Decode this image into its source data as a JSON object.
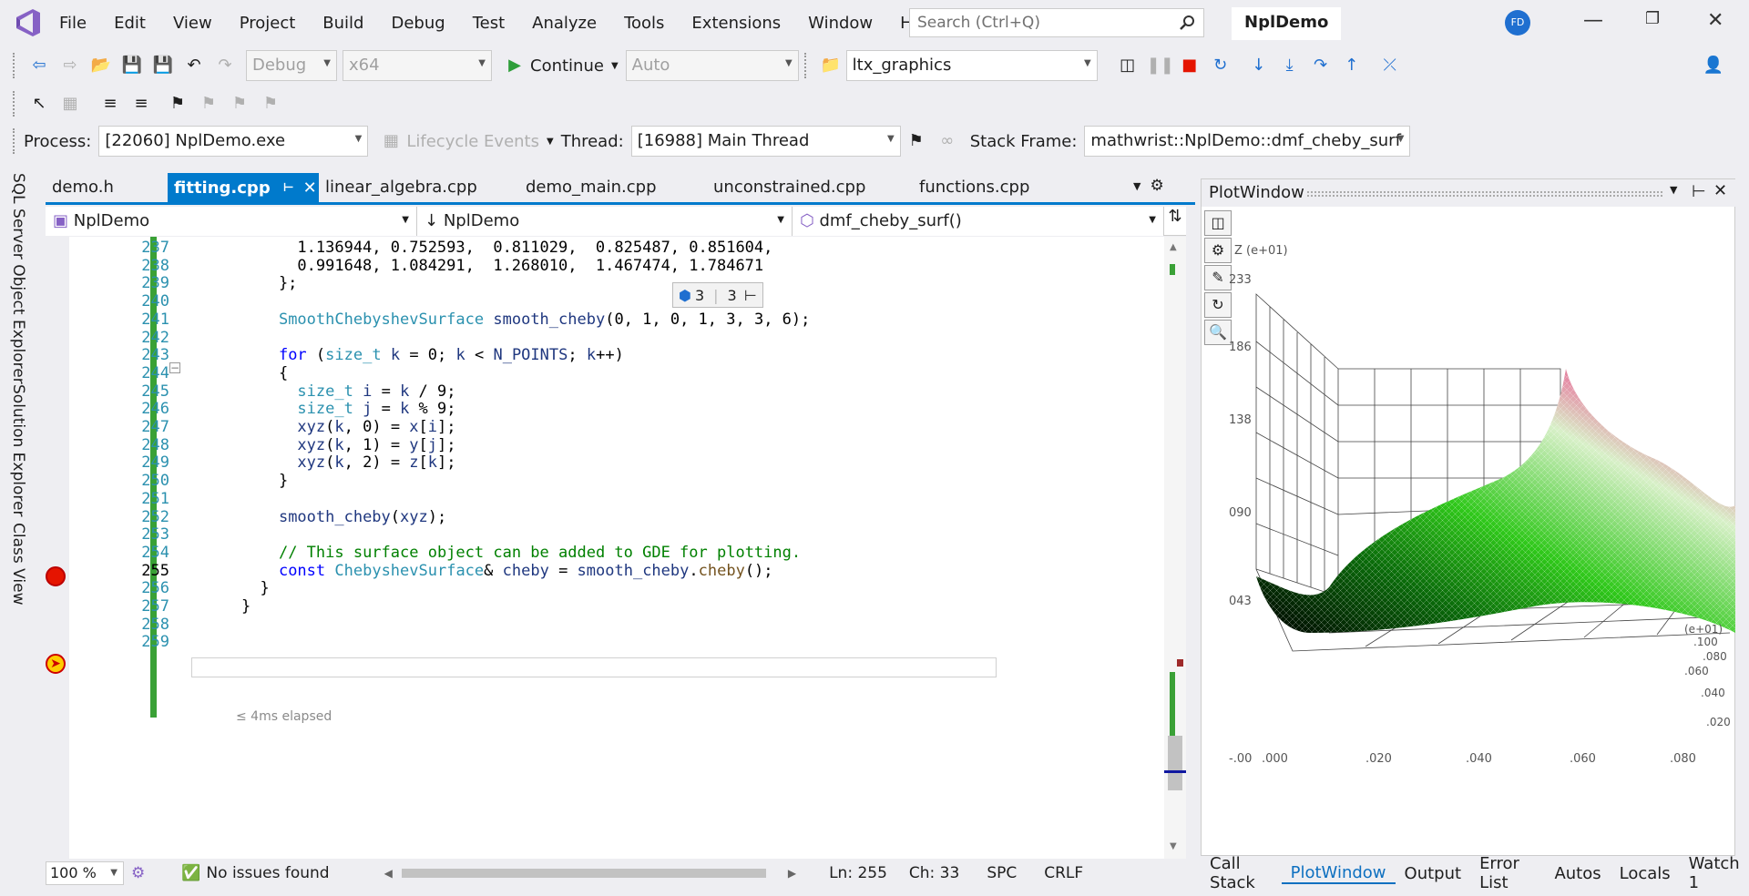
{
  "menu": [
    "File",
    "Edit",
    "View",
    "Project",
    "Build",
    "Debug",
    "Test",
    "Analyze",
    "Tools",
    "Extensions",
    "Window",
    "Help"
  ],
  "search": {
    "placeholder": "Search (Ctrl+Q)"
  },
  "solution_name": "NplDemo",
  "user_initials": "FD",
  "toolbar1": {
    "config": "Debug",
    "platform": "x64",
    "continue_label": "Continue",
    "auto": "Auto",
    "project_combo": "ltx_graphics"
  },
  "debug_location": {
    "process_label": "Process:",
    "process_value": "[22060] NplDemo.exe",
    "lifecycle_label": "Lifecycle Events",
    "thread_label": "Thread:",
    "thread_value": "[16988] Main Thread",
    "stackframe_label": "Stack Frame:",
    "stackframe_value": "mathwrist::NplDemo::dmf_cheby_surf"
  },
  "doc_tabs": [
    "demo.h",
    "fitting.cpp",
    "linear_algebra.cpp",
    "demo_main.cpp",
    "unconstrained.cpp",
    "functions.cpp"
  ],
  "active_tab": "fitting.cpp",
  "navbar": {
    "project": "NplDemo",
    "scope": "NplDemo",
    "member": "dmf_cheby_surf()"
  },
  "left_dock": [
    "SQL Server Object Explorer",
    "Solution Explorer",
    "Class View"
  ],
  "code_lines": [
    {
      "n": "237",
      "segs": [
        [
          "      1.136944, 0.752593,  0.811029,  0.825487, 0.851604,",
          "nm"
        ]
      ]
    },
    {
      "n": "238",
      "segs": [
        [
          "      0.991648, 1.084291,  1.268010,  1.467474, 1.784671",
          "nm"
        ]
      ]
    },
    {
      "n": "239",
      "segs": [
        [
          "    };",
          "nm"
        ]
      ]
    },
    {
      "n": "240",
      "segs": [
        [
          "",
          "nm"
        ]
      ]
    },
    {
      "n": "241",
      "segs": [
        [
          "    ",
          "nm"
        ],
        [
          "SmoothChebyshevSurface",
          "ty"
        ],
        [
          " ",
          "nm"
        ],
        [
          "smooth_cheby",
          "va"
        ],
        [
          "(0, 1, 0, 1, 3, 3, 6);",
          "nm"
        ]
      ]
    },
    {
      "n": "242",
      "segs": [
        [
          "",
          "nm"
        ]
      ]
    },
    {
      "n": "243",
      "segs": [
        [
          "    ",
          "nm"
        ],
        [
          "for",
          "kw"
        ],
        [
          " (",
          "nm"
        ],
        [
          "size_t",
          "ty"
        ],
        [
          " ",
          "nm"
        ],
        [
          "k",
          "va"
        ],
        [
          " = 0; ",
          "nm"
        ],
        [
          "k",
          "va"
        ],
        [
          " < ",
          "nm"
        ],
        [
          "N_POINTS",
          "va"
        ],
        [
          "; ",
          "nm"
        ],
        [
          "k",
          "va"
        ],
        [
          "++)",
          "nm"
        ]
      ]
    },
    {
      "n": "244",
      "segs": [
        [
          "    {",
          "nm"
        ]
      ]
    },
    {
      "n": "245",
      "segs": [
        [
          "      ",
          "nm"
        ],
        [
          "size_t",
          "ty"
        ],
        [
          " ",
          "nm"
        ],
        [
          "i",
          "va"
        ],
        [
          " = ",
          "nm"
        ],
        [
          "k",
          "va"
        ],
        [
          " / 9;",
          "nm"
        ]
      ]
    },
    {
      "n": "246",
      "segs": [
        [
          "      ",
          "nm"
        ],
        [
          "size_t",
          "ty"
        ],
        [
          " ",
          "nm"
        ],
        [
          "j",
          "va"
        ],
        [
          " = ",
          "nm"
        ],
        [
          "k",
          "va"
        ],
        [
          " % 9;",
          "nm"
        ]
      ]
    },
    {
      "n": "247",
      "segs": [
        [
          "      ",
          "nm"
        ],
        [
          "xyz",
          "va"
        ],
        [
          "(",
          "nm"
        ],
        [
          "k",
          "va"
        ],
        [
          ", 0) = ",
          "nm"
        ],
        [
          "x",
          "va"
        ],
        [
          "[",
          "nm"
        ],
        [
          "i",
          "va"
        ],
        [
          "];",
          "nm"
        ]
      ]
    },
    {
      "n": "248",
      "segs": [
        [
          "      ",
          "nm"
        ],
        [
          "xyz",
          "va"
        ],
        [
          "(",
          "nm"
        ],
        [
          "k",
          "va"
        ],
        [
          ", 1) = ",
          "nm"
        ],
        [
          "y",
          "va"
        ],
        [
          "[",
          "nm"
        ],
        [
          "j",
          "va"
        ],
        [
          "];",
          "nm"
        ]
      ]
    },
    {
      "n": "249",
      "segs": [
        [
          "      ",
          "nm"
        ],
        [
          "xyz",
          "va"
        ],
        [
          "(",
          "nm"
        ],
        [
          "k",
          "va"
        ],
        [
          ", 2) = ",
          "nm"
        ],
        [
          "z",
          "va"
        ],
        [
          "[",
          "nm"
        ],
        [
          "k",
          "va"
        ],
        [
          "];",
          "nm"
        ]
      ]
    },
    {
      "n": "250",
      "segs": [
        [
          "    }",
          "nm"
        ]
      ]
    },
    {
      "n": "251",
      "segs": [
        [
          "",
          "nm"
        ]
      ]
    },
    {
      "n": "252",
      "segs": [
        [
          "    ",
          "nm"
        ],
        [
          "smooth_cheby",
          "va"
        ],
        [
          "(",
          "nm"
        ],
        [
          "xyz",
          "va"
        ],
        [
          ");",
          "nm"
        ]
      ]
    },
    {
      "n": "253",
      "segs": [
        [
          "",
          "nm"
        ]
      ]
    },
    {
      "n": "254",
      "segs": [
        [
          "    ",
          "nm"
        ],
        [
          "// This surface object can be added to GDE for plotting.",
          "cm"
        ]
      ]
    },
    {
      "n": "255",
      "segs": [
        [
          "    ",
          "nm"
        ],
        [
          "const",
          "kw"
        ],
        [
          " ",
          "nm"
        ],
        [
          "ChebyshevSurface",
          "ty"
        ],
        [
          "& ",
          "nm"
        ],
        [
          "cheby",
          "va"
        ],
        [
          " = ",
          "nm"
        ],
        [
          "smooth_cheby",
          "va"
        ],
        [
          ".",
          "nm"
        ],
        [
          "cheby",
          "fn"
        ],
        [
          "();",
          "nm"
        ]
      ]
    },
    {
      "n": "256",
      "segs": [
        [
          "  }",
          "nm"
        ]
      ]
    },
    {
      "n": "257",
      "segs": [
        [
          "}",
          "nm"
        ]
      ]
    },
    {
      "n": "258",
      "segs": [
        [
          "",
          "nm"
        ]
      ]
    },
    {
      "n": "259",
      "segs": [
        [
          "",
          "nm"
        ]
      ]
    }
  ],
  "datatip": {
    "left": "3",
    "right": "3"
  },
  "elapsed": "≤ 4ms elapsed",
  "status": {
    "zoom": "100 %",
    "issues": "No issues found",
    "ln": "Ln: 255",
    "ch": "Ch: 33",
    "spc": "SPC",
    "crlf": "CRLF"
  },
  "plot": {
    "title": "PlotWindow",
    "z_label": "Z (e+01)",
    "z_ticks": [
      "233",
      "186",
      "138",
      "090",
      "043",
      "-.00"
    ],
    "x_ticks": [
      ".000",
      ".020",
      ".040",
      ".060",
      ".080"
    ],
    "y_ticks": [
      "(e+01)",
      ".100",
      ".080",
      ".060",
      ".040",
      ".020"
    ]
  },
  "bottom_tabs": [
    "Call Stack",
    "PlotWindow",
    "Output",
    "Error List",
    "Autos",
    "Locals",
    "Watch 1"
  ],
  "bottom_active": "PlotWindow"
}
